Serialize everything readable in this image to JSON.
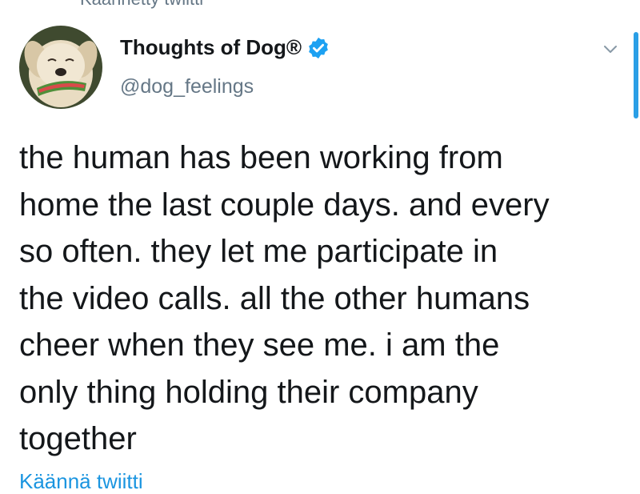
{
  "header": {
    "context_text": "Käännetty twiitti"
  },
  "author": {
    "display_name": "Thoughts of Dog®",
    "handle": "@dog_feelings",
    "verified": true,
    "avatar_icon": "dog-avatar-icon",
    "verified_icon": "verified-badge-icon"
  },
  "tweet": {
    "lines": [
      "the human has been working from",
      "home the last couple days. and every",
      "so often. they let me participate in",
      "the video calls. all the other humans",
      "cheer when they see me. i am the",
      "only thing holding their company",
      "together"
    ]
  },
  "actions": {
    "translate_label": "Käännä twiitti",
    "menu_icon": "chevron-down-icon"
  },
  "colors": {
    "text": "#14171a",
    "secondary": "#657786",
    "link": "#1b95e0",
    "verified": "#1da1f2"
  }
}
